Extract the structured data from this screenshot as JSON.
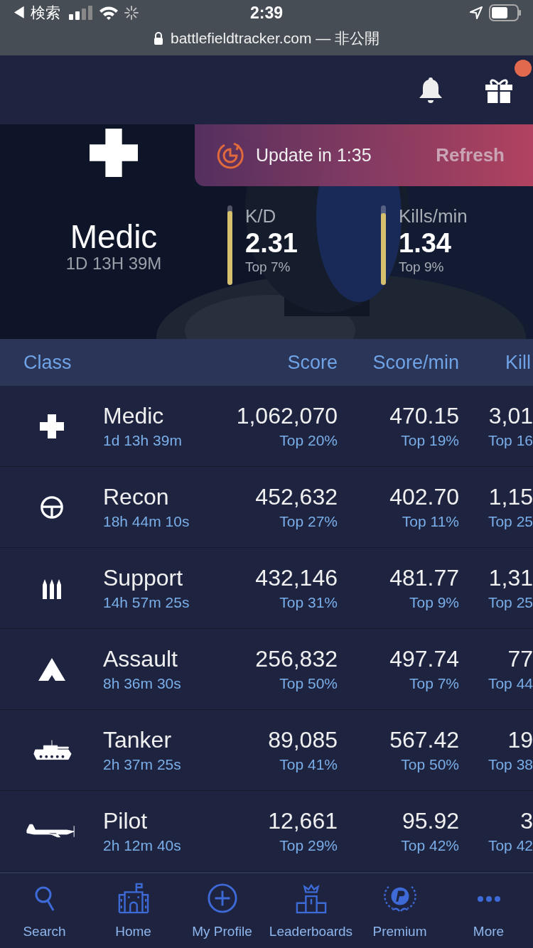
{
  "status_bar": {
    "back": "◀ 検索",
    "time": "2:39",
    "url": "battlefieldtracker.com — 非公開"
  },
  "toast": {
    "text": "Update in 1:35",
    "action": "Refresh"
  },
  "hero": {
    "class": "Medic",
    "time": "1D 13H 39M",
    "stats": [
      {
        "label": "K/D",
        "value": "2.31",
        "rank": "Top 7%",
        "level": 0.93
      },
      {
        "label": "Kills/min",
        "value": "1.34",
        "rank": "Top 9%",
        "level": 0.9
      }
    ]
  },
  "table": {
    "columns": [
      "Class",
      "Score",
      "Score/min",
      "Kill"
    ],
    "rows": [
      {
        "kind": "medic",
        "name": "Medic",
        "time": "1d 13h 39m",
        "score": "1,062,070",
        "score_rank": "Top 20%",
        "spm": "470.15",
        "spm_rank": "Top 19%",
        "kills": "3,01",
        "kills_rank": "Top 16"
      },
      {
        "kind": "recon",
        "name": "Recon",
        "time": "18h 44m 10s",
        "score": "452,632",
        "score_rank": "Top 27%",
        "spm": "402.70",
        "spm_rank": "Top 11%",
        "kills": "1,15",
        "kills_rank": "Top 25"
      },
      {
        "kind": "support",
        "name": "Support",
        "time": "14h 57m 25s",
        "score": "432,146",
        "score_rank": "Top 31%",
        "spm": "481.77",
        "spm_rank": "Top 9%",
        "kills": "1,31",
        "kills_rank": "Top 25"
      },
      {
        "kind": "assault",
        "name": "Assault",
        "time": "8h 36m 30s",
        "score": "256,832",
        "score_rank": "Top 50%",
        "spm": "497.74",
        "spm_rank": "Top 7%",
        "kills": "77",
        "kills_rank": "Top 44"
      },
      {
        "kind": "tanker",
        "name": "Tanker",
        "time": "2h 37m 25s",
        "score": "89,085",
        "score_rank": "Top 41%",
        "spm": "567.42",
        "spm_rank": "Top 50%",
        "kills": "19",
        "kills_rank": "Top 38"
      },
      {
        "kind": "pilot",
        "name": "Pilot",
        "time": "2h 12m 40s",
        "score": "12,661",
        "score_rank": "Top 29%",
        "spm": "95.92",
        "spm_rank": "Top 42%",
        "kills": "3",
        "kills_rank": "Top 42"
      }
    ]
  },
  "nav": [
    {
      "kind": "search",
      "label": "Search"
    },
    {
      "kind": "home",
      "label": "Home"
    },
    {
      "kind": "profile",
      "label": "My Profile"
    },
    {
      "kind": "leaderboards",
      "label": "Leaderboards"
    },
    {
      "kind": "premium",
      "label": "Premium"
    },
    {
      "kind": "more",
      "label": "More"
    }
  ]
}
